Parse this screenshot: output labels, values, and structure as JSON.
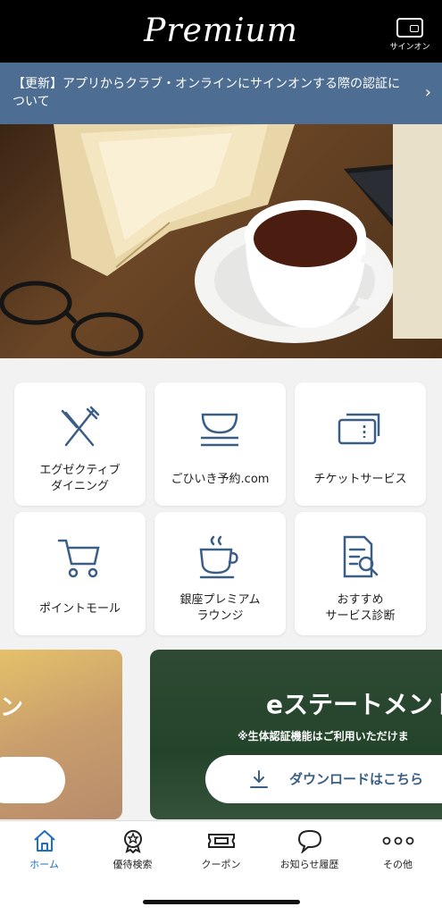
{
  "header": {
    "logo": "Premium",
    "signon_label": "サインオン"
  },
  "banner": {
    "text": "【更新】アプリからクラブ・オンラインにサインオンする際の認証について"
  },
  "hero": {
    "alt": "hero-image-coffee-book"
  },
  "tiles": [
    {
      "label": "エグゼクティブ\nダイニング",
      "icon": "fork-knife-icon"
    },
    {
      "label": "ごひいき予約.com",
      "icon": "bowl-icon"
    },
    {
      "label": "チケットサービス",
      "icon": "ticket-icon"
    },
    {
      "label": "ポイントモール",
      "icon": "cart-icon"
    },
    {
      "label": "銀座プレミアム\nラウンジ",
      "icon": "coffee-cup-icon"
    },
    {
      "label": "おすすめ\nサービス診断",
      "icon": "document-search-icon"
    }
  ],
  "promo_left": {
    "text": "ン"
  },
  "promo_right": {
    "title": "eステートメント",
    "note": "※生体認証機能はご利用いただけま",
    "button_label": "ダウンロードはこちら"
  },
  "tabbar": [
    {
      "label": "ホーム",
      "icon": "home-icon",
      "active": true
    },
    {
      "label": "優待検索",
      "icon": "badge-search-icon",
      "active": false
    },
    {
      "label": "クーポン",
      "icon": "coupon-icon",
      "active": false
    },
    {
      "label": "お知らせ履歴",
      "icon": "speech-bubble-icon",
      "active": false
    },
    {
      "label": "その他",
      "icon": "more-dots-icon",
      "active": false
    }
  ],
  "colors": {
    "header": "#000000",
    "banner": "#4d6e92",
    "accent": "#1d6fc4",
    "icon": "#3a5e86"
  }
}
